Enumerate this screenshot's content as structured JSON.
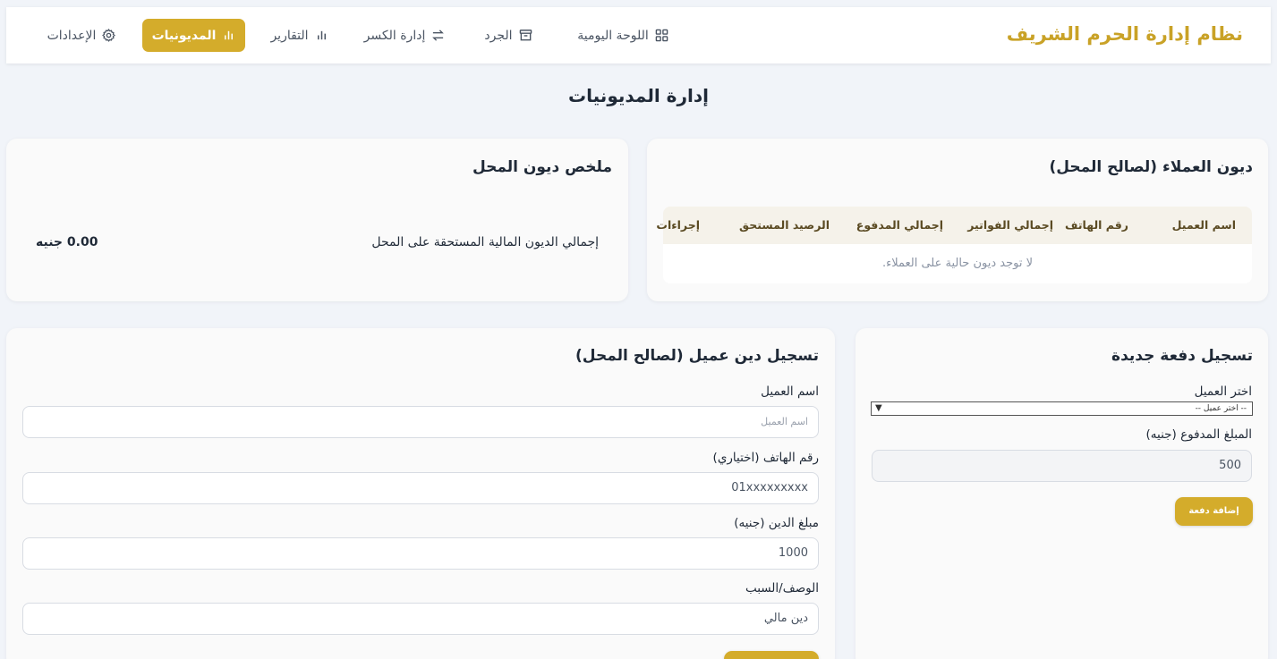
{
  "brand": "نظام إدارة الحرم الشريف",
  "nav": {
    "items": [
      {
        "label": "اللوحة اليومية",
        "icon": "grid-icon"
      },
      {
        "label": "الجرد",
        "icon": "archive-icon"
      },
      {
        "label": "إدارة الكسر",
        "icon": "exchange-icon"
      },
      {
        "label": "التقارير",
        "icon": "bar-chart-icon"
      },
      {
        "label": "المديونيات",
        "icon": "bar-chart-icon",
        "active": true
      },
      {
        "label": "الإعدادات",
        "icon": "gear-icon"
      }
    ]
  },
  "page_title": "إدارة المديونيات",
  "customer_debts": {
    "title": "ديون العملاء (لصالح المحل)",
    "columns": [
      "اسم العميل",
      "رقم الهاتف",
      "إجمالي الفواتير",
      "إجمالي المدفوع",
      "الرصيد المستحق",
      "إجراءات"
    ],
    "empty_text": "لا توجد ديون حالية على العملاء."
  },
  "summary": {
    "title": "ملخص ديون المحل",
    "label": "إجمالي الديون المالية المستحقة على المحل",
    "value": "0.00 جنيه"
  },
  "payment_form": {
    "title": "تسجيل دفعة جديدة",
    "customer_label": "اختر العميل",
    "customer_selected": "-- اختر عميل --",
    "amount_label": "المبلغ المدفوع (جنيه)",
    "amount_placeholder": "500",
    "submit_label": "إضافة دفعة"
  },
  "debt_form": {
    "title": "تسجيل دين عميل (لصالح المحل)",
    "name_label": "اسم العميل",
    "name_placeholder": "اسم العميل",
    "phone_label": "رقم الهاتف (اختياري)",
    "phone_placeholder": "01xxxxxxxxx",
    "amount_label": "مبلغ الدين (جنيه)",
    "amount_placeholder": "1000",
    "reason_label": "الوصف/السبب",
    "reason_placeholder": "دين مالي"
  },
  "colors": {
    "accent": "#d4ac2b",
    "brand": "#c9a227",
    "background": "#f1f4f9"
  }
}
